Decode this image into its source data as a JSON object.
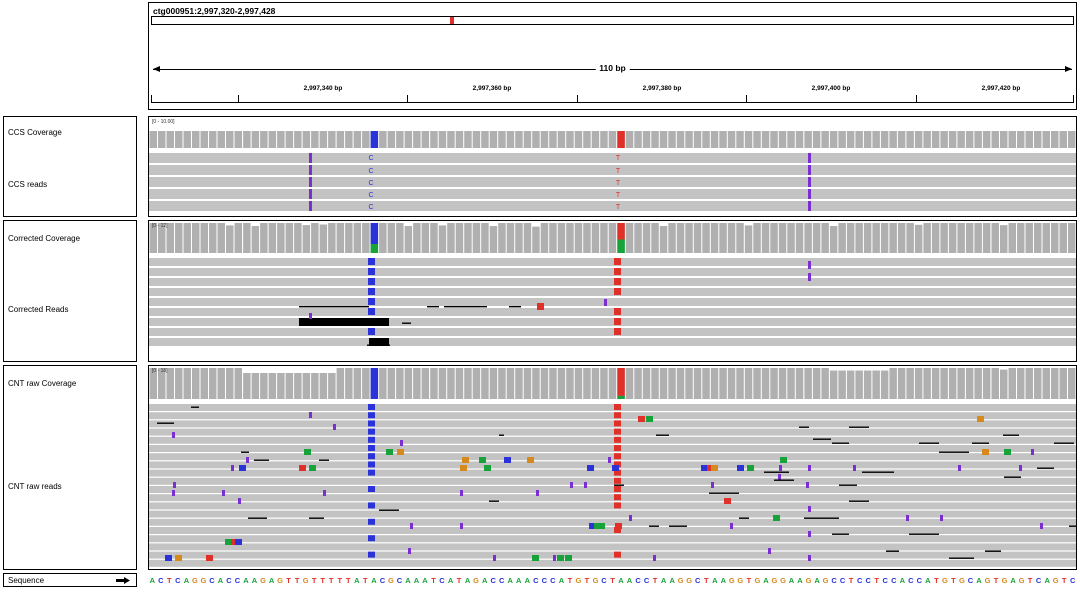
{
  "locus": "ctg000951:2,997,320-2,997,428",
  "span_label": "110 bp",
  "ruler_ticks": [
    "2,997,340 bp",
    "2,997,360 bp",
    "2,997,380 bp",
    "2,997,400 bp",
    "2,997,420 bp"
  ],
  "tracks": {
    "ccs_coverage": {
      "label": "CCS Coverage",
      "range": "[0 - 10.00]"
    },
    "ccs_reads": {
      "label": "CCS reads",
      "mismatch_c": "C",
      "mismatch_t": "T"
    },
    "corrected_coverage": {
      "label": "Corrected Coverage",
      "range": "[0 - 12]"
    },
    "corrected_reads": {
      "label": "Corrected Reads"
    },
    "cnt_coverage": {
      "label": "CNT raw Coverage",
      "range": "[0 - 18]"
    },
    "cnt_reads": {
      "label": "CNT raw reads"
    }
  },
  "sequence": {
    "label": "Sequence",
    "bases": "ACTCAGGCACCAAGAGTTGTTTTTATACGCAAATCATAGACCAAACCCATGTGCTAACCTAAGGCTAAGGTGAGGAAGAGCCTCCTCCACCATGTGCAGTGAGTCAGTC"
  },
  "colors": {
    "A": "#18a23a",
    "C": "#2a32d8",
    "G": "#d68a1e",
    "T": "#e0302a",
    "insertion": "#7a2fd0",
    "read": "#c3c3c3",
    "coverage": "#b0b0b0"
  }
}
